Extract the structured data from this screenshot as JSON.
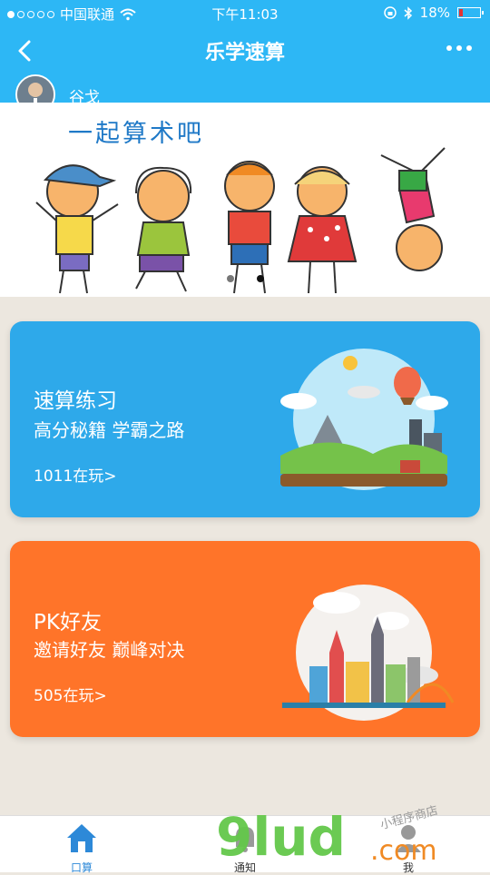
{
  "status": {
    "carrier": "中国联通",
    "time": "下午11:03",
    "battery": "18%",
    "battery_level": 0.18,
    "colors": {
      "battery_low": "#e33333"
    }
  },
  "nav": {
    "title": "乐学速算",
    "back_icon": "chevron-left-icon",
    "more_icon": "more-icon"
  },
  "user": {
    "name": "谷戈"
  },
  "banner": {
    "text": "一起算术吧",
    "page_count": 2,
    "active_page": 2
  },
  "cards": [
    {
      "title": "速算练习",
      "subtitle": "高分秘籍 学霸之路",
      "count": "1011在玩>",
      "color": "#2ea9ea"
    },
    {
      "title": "PK好友",
      "subtitle": "邀请好友 巅峰对决",
      "count": "505在玩>",
      "color": "#ff7429"
    }
  ],
  "tabs": [
    {
      "label": "口算",
      "icon": "home-icon",
      "active": true
    },
    {
      "label": "通知",
      "icon": "bell-icon",
      "active": false
    },
    {
      "label": "我",
      "icon": "user-icon",
      "active": false
    }
  ],
  "watermark": {
    "text": "9lud",
    "domain": ".com",
    "tagline": "小程序商店"
  }
}
